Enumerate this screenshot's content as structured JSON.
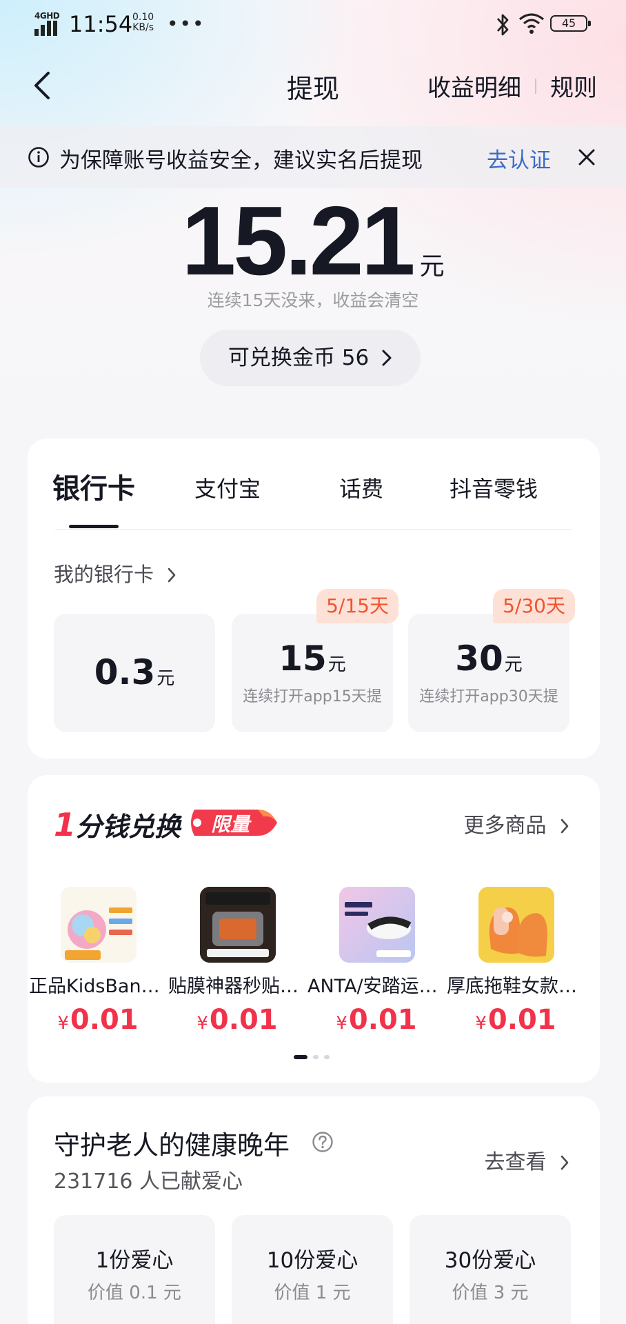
{
  "status_bar": {
    "network": "4GHD",
    "time": "11:54",
    "speed_value": "0.10",
    "speed_unit": "KB/s",
    "battery": "45"
  },
  "nav": {
    "title": "提现",
    "detail_link": "收益明细",
    "rules_link": "规则"
  },
  "notice": {
    "text": "为保障账号收益安全，建议实名后提现",
    "action": "去认证"
  },
  "balance": {
    "amount": "15.21",
    "unit": "元",
    "hint": "连续15天没来，收益会清空",
    "coins_label": "可兑换金币 56"
  },
  "withdraw": {
    "tabs": [
      "银行卡",
      "支付宝",
      "话费",
      "抖音零钱"
    ],
    "active_tab": 0,
    "my_card_label": "我的银行卡",
    "options": [
      {
        "value": "0.3",
        "unit": "元",
        "subtitle": "",
        "badge": ""
      },
      {
        "value": "15",
        "unit": "元",
        "subtitle": "连续打开app15天提",
        "badge": "5/15天"
      },
      {
        "value": "30",
        "unit": "元",
        "subtitle": "连续打开app30天提",
        "badge": "5/30天"
      }
    ]
  },
  "deals": {
    "title_num": "1",
    "title_text": "分钱兑换",
    "limited_label": "限量",
    "more_label": "更多商品",
    "products": [
      {
        "name": "正品KidsBand儿童发圈",
        "currency": "¥",
        "price": "0.01"
      },
      {
        "name": "贴膜神器秒贴无尘舱",
        "currency": "¥",
        "price": "0.01"
      },
      {
        "name": "ANTA/安踏运动发带",
        "currency": "¥",
        "price": "0.01"
      },
      {
        "name": "厚底拖鞋女款夏季",
        "currency": "¥",
        "price": "0.01"
      }
    ]
  },
  "charity": {
    "title": "守护老人的健康晚年",
    "count": "231716 人已献爱心",
    "go_label": "去查看",
    "options": [
      {
        "label": "1份爱心",
        "price": "价值 0.1 元"
      },
      {
        "label": "10份爱心",
        "price": "价值 1 元"
      },
      {
        "label": "30份爱心",
        "price": "价值 3 元"
      }
    ]
  },
  "colors": {
    "accent_red": "#f1324a",
    "link_blue": "#3a6bc8",
    "badge_orange": "#f2542d"
  }
}
